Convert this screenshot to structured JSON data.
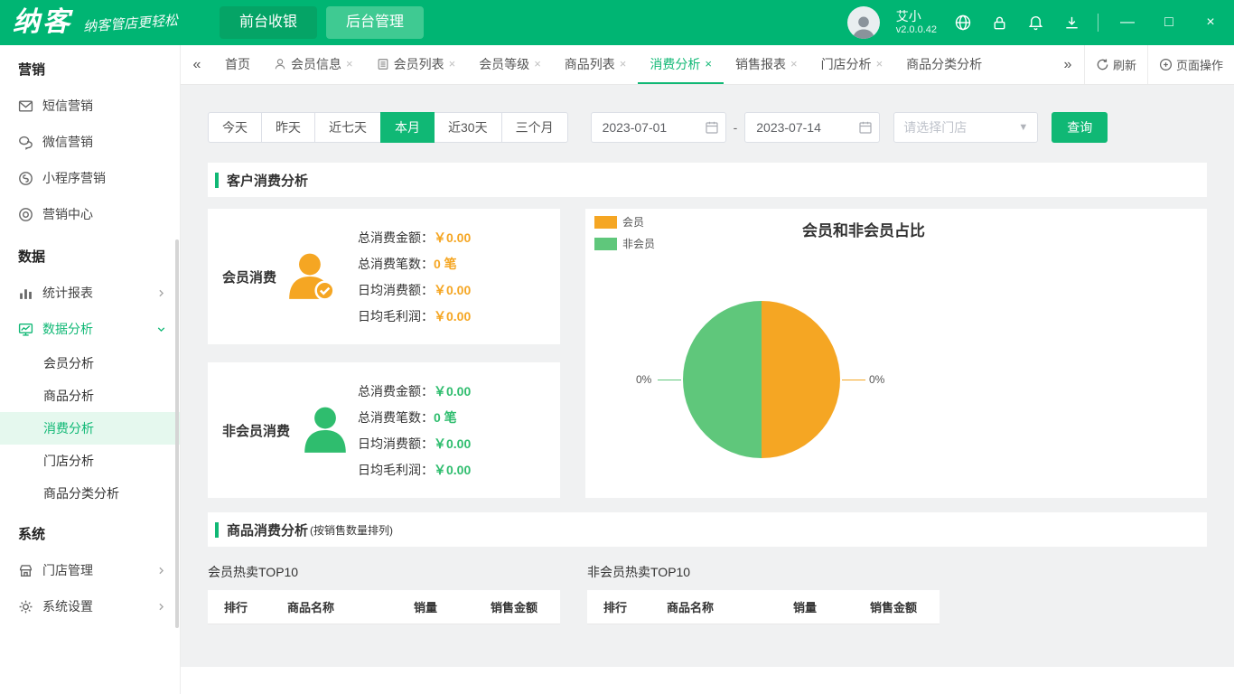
{
  "topbar": {
    "logo": "纳客",
    "slogan": "纳客管店更轻松",
    "nav_tabs": [
      {
        "label": "前台收银"
      },
      {
        "label": "后台管理"
      }
    ],
    "user": {
      "name": "艾小",
      "version": "v2.0.0.42"
    },
    "window_controls": {
      "minimize": "—",
      "maximize": "□",
      "close": "×"
    }
  },
  "sidebar": {
    "sections": [
      {
        "title": "营销",
        "items": [
          {
            "label": "短信营销"
          },
          {
            "label": "微信营销"
          },
          {
            "label": "小程序营销"
          },
          {
            "label": "营销中心"
          }
        ]
      },
      {
        "title": "数据",
        "items": [
          {
            "label": "统计报表"
          },
          {
            "label": "数据分析",
            "children": [
              {
                "label": "会员分析"
              },
              {
                "label": "商品分析"
              },
              {
                "label": "消费分析"
              },
              {
                "label": "门店分析"
              },
              {
                "label": "商品分类分析"
              }
            ]
          }
        ]
      },
      {
        "title": "系统",
        "items": [
          {
            "label": "门店管理"
          },
          {
            "label": "系统设置"
          }
        ]
      }
    ]
  },
  "tabbar": {
    "left_arrow": "«",
    "right_arrow": "»",
    "tabs": [
      {
        "label": "首页"
      },
      {
        "label": "会员信息",
        "close": "×"
      },
      {
        "label": "会员列表",
        "close": "×"
      },
      {
        "label": "会员等级",
        "close": "×"
      },
      {
        "label": "商品列表",
        "close": "×"
      },
      {
        "label": "消费分析",
        "close": "×"
      },
      {
        "label": "销售报表",
        "close": "×"
      },
      {
        "label": "门店分析",
        "close": "×"
      },
      {
        "label": "商品分类分析"
      }
    ],
    "refresh_label": "刷新",
    "page_ops_label": "页面操作"
  },
  "filters": {
    "ranges": [
      "今天",
      "昨天",
      "近七天",
      "本月",
      "近30天",
      "三个月"
    ],
    "active_range": "本月",
    "date_from": "2023-07-01",
    "date_separator": "-",
    "date_to": "2023-07-14",
    "store_placeholder": "请选择门店",
    "query_label": "查询"
  },
  "customer_section": {
    "title": "客户消费分析",
    "member_card": {
      "title": "会员消费",
      "rows": [
        {
          "label": "总消费金额：",
          "value": "￥0.00"
        },
        {
          "label": "总消费笔数：",
          "value": "0 笔"
        },
        {
          "label": "日均消费额：",
          "value": "￥0.00"
        },
        {
          "label": "日均毛利润：",
          "value": "￥0.00"
        }
      ]
    },
    "nonmember_card": {
      "title": "非会员消费",
      "rows": [
        {
          "label": "总消费金额：",
          "value": "￥0.00"
        },
        {
          "label": "总消费笔数：",
          "value": "0 笔"
        },
        {
          "label": "日均消费额：",
          "value": "￥0.00"
        },
        {
          "label": "日均毛利润：",
          "value": "￥0.00"
        }
      ]
    }
  },
  "chart_data": {
    "type": "pie",
    "title": "会员和非会员占比",
    "legend_position": "top-left",
    "slices": [
      {
        "label": "会员",
        "display_pct": "0%",
        "visual_fraction": 50,
        "color": "#f5a623"
      },
      {
        "label": "非会员",
        "display_pct": "0%",
        "visual_fraction": 50,
        "color": "#5fc77b"
      }
    ]
  },
  "product_section": {
    "title": "商品消费分析",
    "subtitle": "(按销售数量排列)",
    "tables": [
      {
        "title": "会员热卖TOP10",
        "headers": [
          "排行",
          "商品名称",
          "销量",
          "销售金额"
        ],
        "rows": []
      },
      {
        "title": "非会员热卖TOP10",
        "headers": [
          "排行",
          "商品名称",
          "销量",
          "销售金额"
        ],
        "rows": []
      }
    ]
  },
  "colors": {
    "primary_green": "#10b875",
    "member_orange": "#f5a623",
    "nonmember_green": "#2fbd6e",
    "pie_green": "#5fc77b"
  }
}
